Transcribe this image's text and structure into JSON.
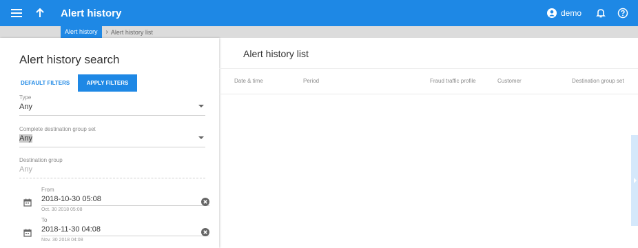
{
  "header": {
    "title": "Alert history",
    "user_label": "demo"
  },
  "breadcrumb": {
    "parent": "Alert history",
    "current": "Alert history list"
  },
  "search": {
    "title": "Alert history search",
    "default_filters_label": "DEFAULT FILTERS",
    "apply_filters_label": "APPLY FILTERS",
    "type": {
      "label": "Type",
      "value": "Any"
    },
    "complete_destination_group_set": {
      "label": "Complete destination group set",
      "value": "Any"
    },
    "destination_group": {
      "label": "Destination group",
      "value": "Any"
    },
    "from": {
      "label": "From",
      "value": "2018-10-30 05:08",
      "hint": "Oct. 30 2018 05:08"
    },
    "to": {
      "label": "To",
      "value": "2018-11-30 04:08",
      "hint": "Nov. 30 2018 04:08"
    }
  },
  "list": {
    "title": "Alert history list",
    "columns": [
      "Date & time",
      "Period",
      "Fraud traffic profile",
      "Customer",
      "Destination group set"
    ]
  },
  "colors": {
    "accent": "#1e88e5",
    "crumbbar": "#dcdcdc",
    "side_tab": "#d5e8fb"
  },
  "icons": [
    "menu-icon",
    "arrow-up-icon",
    "account-icon",
    "bell-icon",
    "help-icon",
    "calendar-icon",
    "clear-icon",
    "chevron-down-icon"
  ]
}
